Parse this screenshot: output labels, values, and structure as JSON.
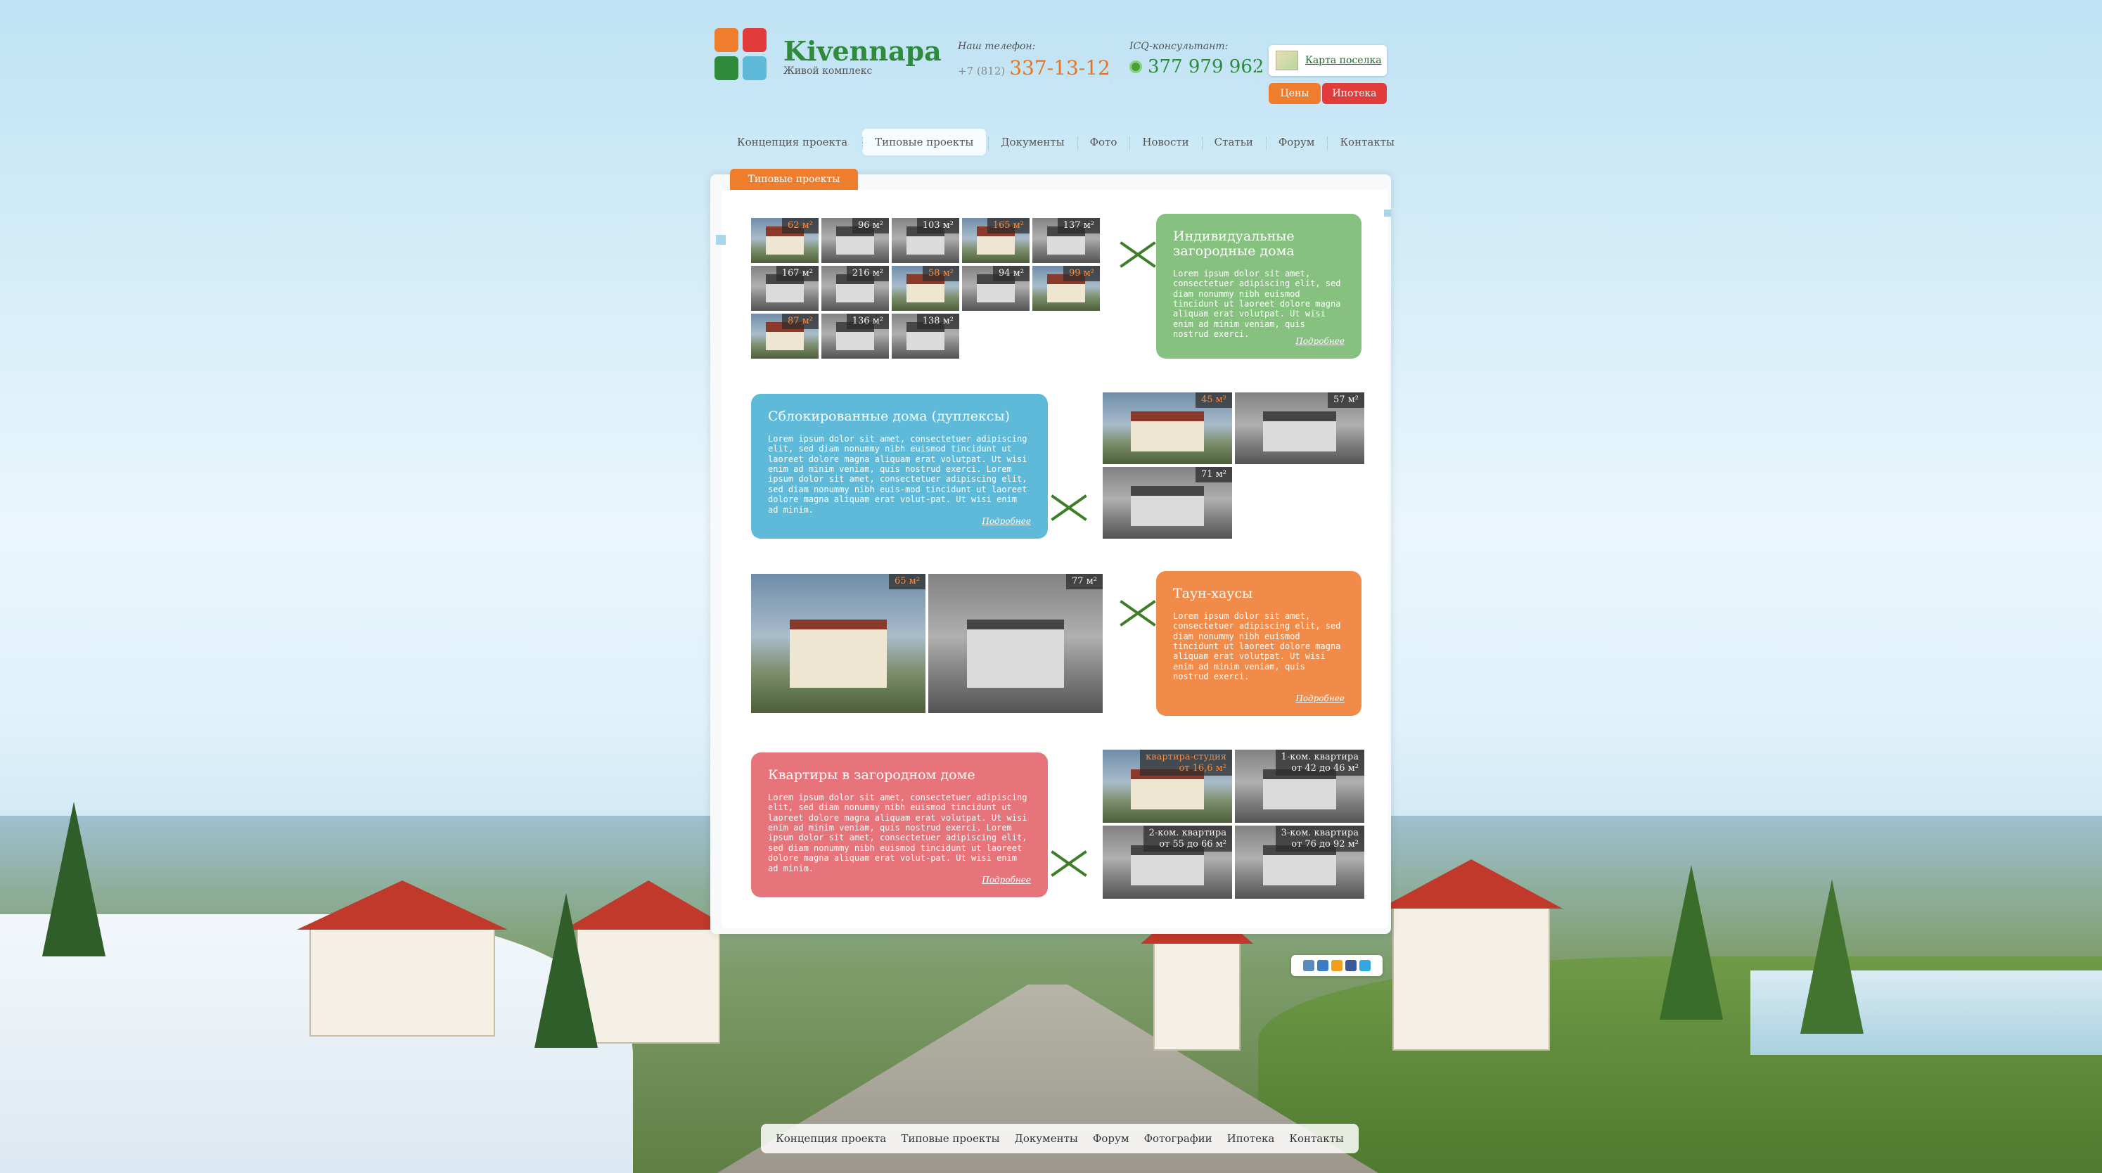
{
  "header": {
    "logo_title": "Kivennapa",
    "logo_subtitle": "Живой комплекс",
    "phone_label": "Наш телефон:",
    "phone_prefix": "+7 (812)",
    "phone_number": "337-13-12",
    "icq_label": "ICQ-консультант:",
    "icq_number": "377 979 962",
    "map_link": "Карта поселка",
    "prices_button": "Цены",
    "mortgage_button": "Ипотека"
  },
  "nav": {
    "items": [
      "Концепция проекта",
      "Типовые проекты",
      "Документы",
      "Фото",
      "Новости",
      "Статьи",
      "Форум",
      "Контакты"
    ],
    "active_index": 1
  },
  "section_tab": "Типовые проекты",
  "individual": {
    "thumbs": [
      "62 м²",
      "96 м²",
      "103 м²",
      "165 м²",
      "137 м²",
      "167 м²",
      "216 м²",
      "58 м²",
      "94 м²",
      "99 м²",
      "87 м²",
      "136 м²",
      "138 м²"
    ],
    "title": "Индивидуальные загородные дома",
    "text": "Lorem ipsum dolor sit amet, consectetuer adipiscing elit, sed diam nonummy nibh euismod tincidunt ut laoreet dolore magna aliquam erat volutpat. Ut wisi enim ad minim veniam, quis nostrud exerci.",
    "more": "Подробнее"
  },
  "duplex": {
    "title": "Сблокированные дома (дуплексы)",
    "text": "Lorem ipsum dolor sit amet, consectetuer adipiscing elit, sed diam nonummy nibh euismod tincidunt ut laoreet dolore magna aliquam erat volutpat. Ut wisi enim ad minim veniam, quis nostrud exerci. Lorem ipsum dolor sit amet, consectetuer adipiscing elit, sed diam nonummy nibh euis-mod tincidunt ut laoreet dolore magna aliquam erat volut-pat. Ut wisi enim ad minim.",
    "more": "Подробнее",
    "thumbs": [
      "45 м²",
      "57 м²",
      "71 м²"
    ]
  },
  "townhouse": {
    "thumbs": [
      "65 м²",
      "77 м²"
    ],
    "title": "Таун-хаусы",
    "text": "Lorem ipsum dolor sit amet, consectetuer adipiscing elit, sed diam nonummy nibh euismod tincidunt ut laoreet dolore magna aliquam erat volutpat. Ut wisi enim ad minim veniam, quis nostrud exerci.",
    "more": "Подробнее"
  },
  "apartments": {
    "title": "Квартиры в загородном доме",
    "text": "Lorem ipsum dolor sit amet, consectetuer adipiscing elit, sed diam nonummy nibh euismod tincidunt ut laoreet dolore magna aliquam erat volutpat. Ut wisi enim ad minim veniam, quis nostrud exerci. Lorem ipsum dolor sit amet, consectetuer adipiscing elit, sed diam nonummy nibh euismod tincidunt ut laoreet dolore magna aliquam erat volut-pat. Ut wisi enim ad minim.",
    "more": "Подробнее",
    "thumbs": [
      {
        "l1": "квартира-студия",
        "l2": "от 16,6 м²"
      },
      {
        "l1": "1-ком. квартира",
        "l2": "от 42 до 46 м²"
      },
      {
        "l1": "2-ком. квартира",
        "l2": "от 55 до 66 м²"
      },
      {
        "l1": "3-ком. квартира",
        "l2": "от 76 до 92 м²"
      }
    ]
  },
  "footer_nav": [
    "Концепция проекта",
    "Типовые проекты",
    "Документы",
    "Форум",
    "Фотографии",
    "Ипотека",
    "Контакты"
  ],
  "colors": {
    "accent_orange": "#ef7d2e",
    "accent_red": "#e23b3b",
    "brand_green": "#2e8b3a",
    "card_green": "#86c17f",
    "card_blue": "#5fb9d9",
    "card_orange": "#f08b4a",
    "card_red": "#e6747a"
  }
}
